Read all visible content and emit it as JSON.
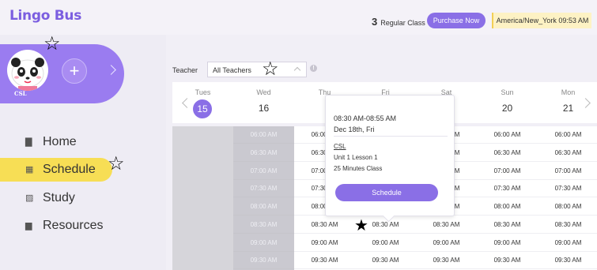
{
  "app": {
    "logo": "Lingo Bus"
  },
  "header": {
    "regular_count": "3",
    "regular_label": "Regular Class",
    "purchase_label": "Purchase Now",
    "timezone": "America/New_York 09:53 AM"
  },
  "profile": {
    "name": "CSL",
    "add_icon": "plus-icon"
  },
  "nav": [
    {
      "label": "Home",
      "icon": "home-icon"
    },
    {
      "label": "Schedule",
      "icon": "calendar-icon"
    },
    {
      "label": "Study",
      "icon": "study-icon"
    },
    {
      "label": "Resources",
      "icon": "briefcase-icon"
    }
  ],
  "filter": {
    "label": "Teacher",
    "value": "All Teachers"
  },
  "calendar": {
    "days": [
      {
        "name": "Tues",
        "date": "15"
      },
      {
        "name": "Wed",
        "date": "16"
      },
      {
        "name": "Thu",
        "date": ""
      },
      {
        "name": "Fri",
        "date": ""
      },
      {
        "name": "Sat",
        "date": ""
      },
      {
        "name": "Sun",
        "date": "20"
      },
      {
        "name": "Mon",
        "date": "21"
      }
    ],
    "times": [
      "06:00 AM",
      "06:30 AM",
      "07:00 AM",
      "07:30 AM",
      "08:00 AM",
      "08:30 AM",
      "09:00 AM",
      "09:30 AM"
    ]
  },
  "popup": {
    "time": "08:30 AM-08:55 AM",
    "date": "Dec 18th, Fri",
    "name": "CSL",
    "lesson": "Unit 1 Lesson 1",
    "duration": "25 Minutes Class",
    "button": "Schedule"
  },
  "colors": {
    "brand": "#8a6fe6",
    "active": "#f7de55",
    "timezone_bg": "#fdf2c4"
  }
}
